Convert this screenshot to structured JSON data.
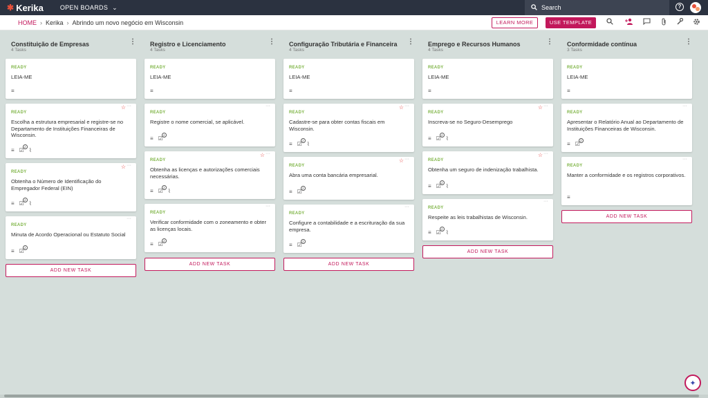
{
  "topbar": {
    "logo": "Kerika",
    "open_boards": "OPEN BOARDS",
    "search_placeholder": "Search",
    "help": "?"
  },
  "subbar": {
    "breadcrumbs": [
      "HOME",
      "Kerika",
      "Abrindo um novo negócio em Wisconsin"
    ],
    "learn_more": "LEARN MORE",
    "use_template": "USE TEMPLATE"
  },
  "columns": [
    {
      "title": "Constituição de Empresas",
      "count": "4 Tasks",
      "add_task": "ADD NEW TASK",
      "cards": [
        {
          "status": "READY",
          "title": "LEIA-ME"
        },
        {
          "status": "READY",
          "title": "Escolha a estrutura empresarial e registre-se no Departamento de Instituições Financeiras de Wisconsin.",
          "badge": "1"
        },
        {
          "status": "READY",
          "title": "Obtenha o Número de Identificação do Empregador Federal (EIN)",
          "badge": "1"
        },
        {
          "status": "READY",
          "title": "Minuta de Acordo Operacional ou Estatuto Social",
          "badge": "1"
        }
      ]
    },
    {
      "title": "Registro e Licenciamento",
      "count": "4 Tasks",
      "add_task": "ADD NEW TASK",
      "cards": [
        {
          "status": "READY",
          "title": "LEIA-ME"
        },
        {
          "status": "READY",
          "title": "Registre o nome comercial, se aplicável.",
          "badge": "1"
        },
        {
          "status": "READY",
          "title": "Obtenha as licenças e autorizações comerciais necessárias.",
          "badge": "1"
        },
        {
          "status": "READY",
          "title": "Verificar conformidade com o zoneamento e obter as licenças locais.",
          "badge": "1"
        }
      ]
    },
    {
      "title": "Configuração Tributária e Financeira",
      "count": "4 Tasks",
      "add_task": "ADD NEW TASK",
      "cards": [
        {
          "status": "READY",
          "title": "LEIA-ME"
        },
        {
          "status": "READY",
          "title": "Cadastre-se para obter contas fiscais em Wisconsin.",
          "badge": "1"
        },
        {
          "status": "READY",
          "title": "Abra uma conta bancária empresarial.",
          "badge": "1"
        },
        {
          "status": "READY",
          "title": "Configure a contabilidade e a escrituração da sua empresa.",
          "badge": "1"
        }
      ]
    },
    {
      "title": "Emprego e Recursos Humanos",
      "count": "4 Tasks",
      "add_task": "ADD NEW TASK",
      "cards": [
        {
          "status": "READY",
          "title": "LEIA-ME"
        },
        {
          "status": "READY",
          "title": "Inscreva-se no Seguro-Desemprego",
          "badge": "1"
        },
        {
          "status": "READY",
          "title": "Obtenha um seguro de indenização trabalhista.",
          "badge": "1"
        },
        {
          "status": "READY",
          "title": "Respeite as leis trabalhistas de Wisconsin.",
          "badge": "1"
        }
      ]
    },
    {
      "title": "Conformidade contínua",
      "count": "3 Tasks",
      "add_task": "ADD NEW TASK",
      "cards": [
        {
          "status": "READY",
          "title": "LEIA-ME"
        },
        {
          "status": "READY",
          "title": "Apresentar o Relatório Anual ao Departamento de Instituições Financeiras de Wisconsin.",
          "badge": "1"
        },
        {
          "status": "READY",
          "title": "Manter a conformidade e os registros corporativos."
        }
      ]
    }
  ],
  "icons": {
    "logo": "kerika-logo-icon",
    "chevron": "chevron-down-icon",
    "search": "search-icon",
    "help": "help-icon",
    "avatar": "avatar",
    "toolbar": [
      "search-icon",
      "add-person-icon",
      "chat-icon",
      "attachment-icon",
      "tools-icon",
      "settings-icon"
    ],
    "card_description": "description-icon",
    "card_checklist": "checklist-icon",
    "card_attachment": "attachment-icon",
    "star": "star-icon",
    "fab": "assistant-icon"
  },
  "colors": {
    "brand": "#c2185b",
    "status_ready": "#7cb342",
    "topbar": "#2b3240",
    "board_bg": "#d5dedb"
  }
}
